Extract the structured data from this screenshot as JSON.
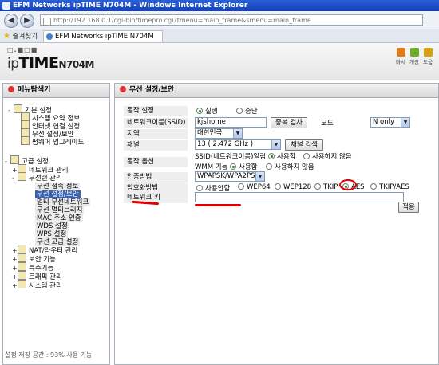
{
  "window": {
    "title": "EFM Networks ipTIME N704M - Windows Internet Explorer",
    "address": "http://192.168.0.1/cgi-bin/timepro.cgi?tmenu=main_frame&smenu=main_frame",
    "favorites_label": "즐겨찾기",
    "tab_title": "EFM Networks ipTIME N704M"
  },
  "header": {
    "logo_dots": "□.■□■",
    "logo_ip": "ip",
    "logo_time": "TIME",
    "logo_model": "N704M",
    "icons": [
      {
        "name": "info-icon",
        "label": "마시",
        "color": "#e07b1a"
      },
      {
        "name": "config-icon",
        "label": "개장",
        "color": "#6cae2a"
      },
      {
        "name": "help-icon",
        "label": "도움",
        "color": "#d7a20f"
      }
    ]
  },
  "menu": {
    "title": "메뉴탐색기",
    "basic_group": "기본 설정",
    "basic_items": [
      "시스템 요약 정보",
      "인터넷 연결 설정",
      "무선 설정/보안",
      "펌웨어 업그레이드"
    ],
    "advanced_group": "고급 설정",
    "network": "네트워크 관리",
    "wireless": "무선랜 관리",
    "wireless_items": [
      "무선 접속 정보",
      "무선 설정/보안",
      "멀티 무선네트워크",
      "무선 멀티브리지",
      "MAC 주소 인증",
      "WDS 설정",
      "WPS 설정",
      "무선 고급 설정"
    ],
    "others": [
      "NAT/라우터 관리",
      "보안 기능",
      "특수기능",
      "트래픽 관리",
      "시스템 관리"
    ],
    "storage": "설정 저장 공간 : 93% 사용 가능"
  },
  "content": {
    "title": "무선 설정/보안",
    "op_label": "동작 설정",
    "op_run": "실행",
    "op_stop": "중단",
    "ssid_label": "네트워크이름(SSID)",
    "ssid_value": "kjshome",
    "dup_button": "중복 검사",
    "mode_label": "모드",
    "mode_value": "N only",
    "region_label": "지역",
    "region_value": "대한민국",
    "channel_label": "채널",
    "channel_value": "13 ( 2.472 GHz )",
    "channel_button": "채널 검색",
    "opt_label": "동작 옵션",
    "ssid_broadcast": "SSID(네트워크이름)알림",
    "ssid_on": "사용함",
    "ssid_off": "사용하지 않음",
    "wmm": "WMM 기능",
    "wmm_on": "사용함",
    "wmm_off": "사용하지 않음",
    "auth_label": "인증방법",
    "auth_value": "WPAPSK/WPA2PSK",
    "enc_label": "암호화방법",
    "enc_options": [
      "사용안함",
      "WEP64",
      "WEP128",
      "TKIP",
      "AES",
      "TKIP/AES"
    ],
    "enc_selected": "AES",
    "key_label": "네트워크 키",
    "key_value": "",
    "apply_button": "적용"
  },
  "colors": {
    "accent": "#3a62b0",
    "annotation": "#e00000"
  }
}
